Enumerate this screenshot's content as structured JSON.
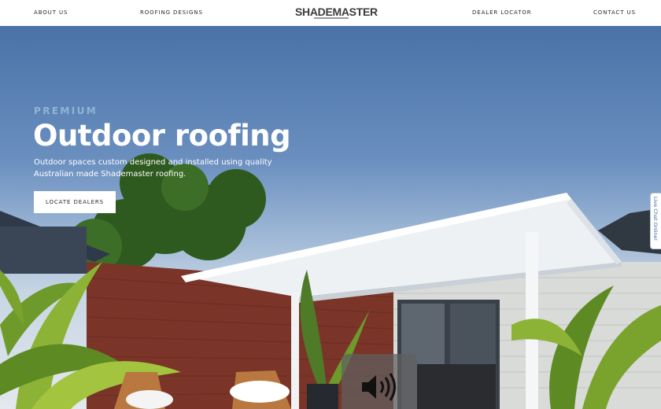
{
  "nav": {
    "about": "ABOUT US",
    "designs": "ROOFING DESIGNS",
    "dealer": "DEALER LOCATOR",
    "contact": "CONTACT US"
  },
  "logo": {
    "text": "SHADEMASTER"
  },
  "hero": {
    "eyebrow": "PREMIUM",
    "title": "Outdoor roofing",
    "description": "Outdoor spaces custom designed and installed using quality Australian made Shademaster roofing.",
    "cta_label": "LOCATE DEALERS"
  },
  "live_chat": {
    "label": "Live Chat Online!"
  },
  "icons": {
    "sound": "speaker-volume-icon"
  },
  "colors": {
    "sky_top": "#4a72a8",
    "eyebrow": "#8fb4d6",
    "brick": "#7a3528",
    "roof_white": "#f2f4f6"
  }
}
